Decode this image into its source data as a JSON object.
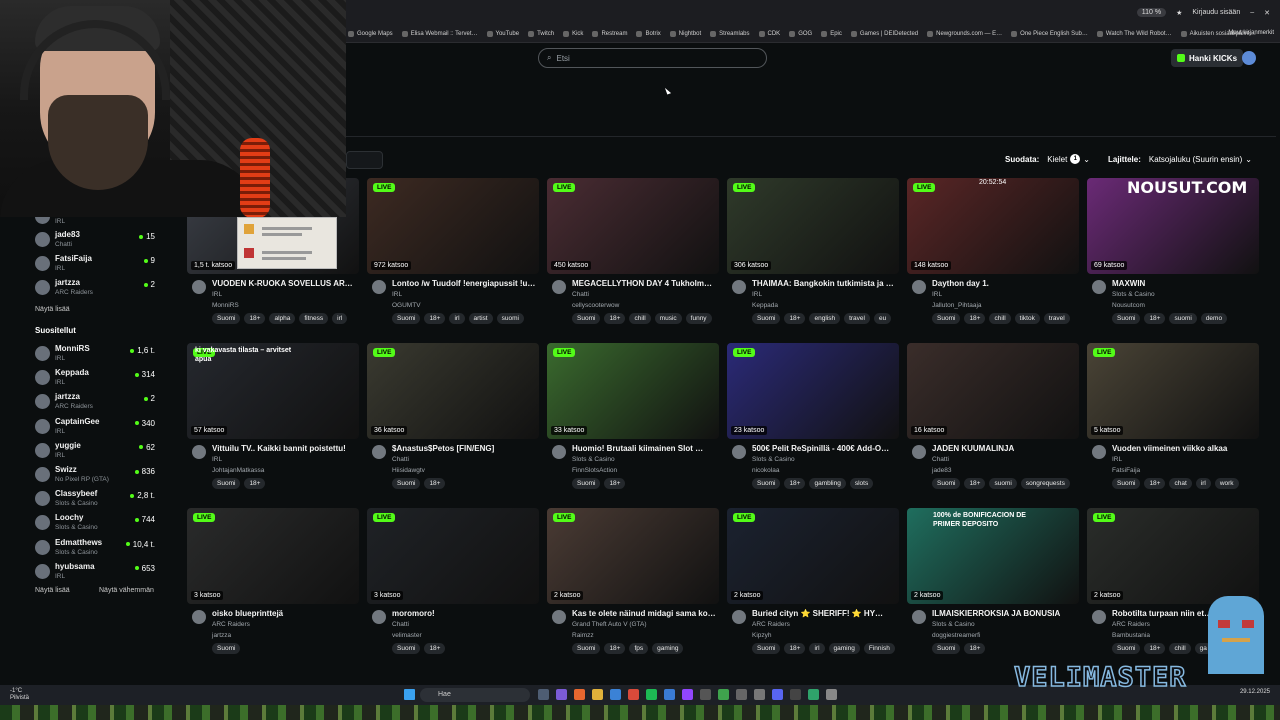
{
  "browser": {
    "zoom": "110 %",
    "account_label": "Kirjaudu sisään",
    "bookmarks": [
      "Google Maps",
      "Elisa Webmail :: Tervet…",
      "YouTube",
      "Twitch",
      "Kick",
      "Restream",
      "Botrix",
      "Nightbot",
      "Streamlabs",
      "CDK",
      "GOG",
      "Epic",
      "Games | DEIDetected",
      "Newgrounds.com — E…",
      "One Piece English Sub…",
      "Watch The Wild Robot…",
      "Aikuisten sosiaalipalve…"
    ],
    "bookmarks_more": "Muut kirjanmerkit"
  },
  "header": {
    "search_placeholder": "Etsi",
    "kicks_label": "Hanki KICKs"
  },
  "filters": {
    "sort_label": "Suodata:",
    "languages_label": "Kielet",
    "languages_count": "1",
    "order_label": "Lajittele:",
    "order_value": "Katsojaluku (Suurin ensin)"
  },
  "sidebar": {
    "following_partial": [
      {
        "name": "",
        "category": "IRL",
        "viewers": ""
      },
      {
        "name": "jade83",
        "category": "Chatti",
        "viewers": "15"
      },
      {
        "name": "FatsiFaija",
        "category": "IRL",
        "viewers": "9"
      },
      {
        "name": "jartzza",
        "category": "ARC Raiders",
        "viewers": "2"
      }
    ],
    "show_more_1": "Näytä lisää",
    "recommended_heading": "Suositellut",
    "recommended": [
      {
        "name": "MonniRS",
        "category": "IRL",
        "viewers": "1,6 t."
      },
      {
        "name": "Keppada",
        "category": "IRL",
        "viewers": "314"
      },
      {
        "name": "jartzza",
        "category": "ARC Raiders",
        "viewers": "2"
      },
      {
        "name": "CaptainGee",
        "category": "IRL",
        "viewers": "340"
      },
      {
        "name": "yuggie",
        "category": "IRL",
        "viewers": "62"
      },
      {
        "name": "Swizz",
        "category": "No Pixel RP (GTA)",
        "viewers": "836"
      },
      {
        "name": "Classybeef",
        "category": "Slots & Casino",
        "viewers": "2,8 t."
      },
      {
        "name": "Loochy",
        "category": "Slots & Casino",
        "viewers": "744"
      },
      {
        "name": "Edmatthews",
        "category": "Slots & Casino",
        "viewers": "10,4 t."
      },
      {
        "name": "hyubsama",
        "category": "IRL",
        "viewers": "653"
      }
    ],
    "show_more_2": "Näytä lisää",
    "show_less": "Näytä vähemmän"
  },
  "cards": [
    {
      "title": "VUODEN K-RUOKA SOVELLUS ARV…",
      "category": "IRL",
      "channel": "MonniRS",
      "viewers": "1,5 t. katsoo",
      "live": "",
      "tags": [
        "Suomi",
        "18+",
        "alpha",
        "fitness",
        "irl"
      ],
      "color": "#3b3f47"
    },
    {
      "title": "Lontoo /w Tuudolf !energiapussit !u…",
      "category": "IRL",
      "channel": "OGUMTV",
      "viewers": "972 katsoo",
      "live": "LIVE",
      "tags": [
        "Suomi",
        "18+",
        "irl",
        "artist",
        "suomi"
      ],
      "color": "#3d2a22"
    },
    {
      "title": "MEGACELLYTHON DAY 4 Tukholm…",
      "category": "Chatti",
      "channel": "cellyscooterwow",
      "viewers": "450 katsoo",
      "live": "LIVE",
      "tags": [
        "Suomi",
        "18+",
        "chill",
        "music",
        "funny"
      ],
      "color": "#4a2c33"
    },
    {
      "title": "THAIMAA: Bangkokin tutkimista ja …",
      "category": "IRL",
      "channel": "Keppada",
      "viewers": "306 katsoo",
      "live": "LIVE",
      "tags": [
        "Suomi",
        "18+",
        "english",
        "travel",
        "eu"
      ],
      "color": "#2f3a2a"
    },
    {
      "title": "Daython day 1.",
      "category": "IRL",
      "channel": "Jalluton_Pihtaaja",
      "viewers": "148 katsoo",
      "live": "LIVE",
      "tags": [
        "Suomi",
        "18+",
        "chill",
        "tiktok",
        "travel"
      ],
      "color": "#5a2626"
    },
    {
      "title": "MAXWIN",
      "category": "Slots & Casino",
      "channel": "Nousutcom",
      "viewers": "69 katsoo",
      "live": "",
      "tags": [
        "Suomi",
        "18+",
        "suomi",
        "demo"
      ],
      "color": "#6a2a76"
    },
    {
      "title": "Vittuilu TV.. Kaikki bannit poistettu!",
      "category": "IRL",
      "channel": "JohtajanMatkassa",
      "viewers": "57 katsoo",
      "live": "LIVE",
      "tags": [
        "Suomi",
        "18+"
      ],
      "color": "#25282e"
    },
    {
      "title": "$Anastus$Petos [FIN/ENG]",
      "category": "Chatti",
      "channel": "Hiisidawgtv",
      "viewers": "36 katsoo",
      "live": "LIVE",
      "tags": [
        "Suomi",
        "18+"
      ],
      "color": "#3a3a30"
    },
    {
      "title": "Huomio! Brutaali kiimainen Slot …",
      "category": "Slots & Casino",
      "channel": "FinnSlotsAction",
      "viewers": "33 katsoo",
      "live": "LIVE",
      "tags": [
        "Suomi",
        "18+"
      ],
      "color": "#3a6a2e"
    },
    {
      "title": "500€ Pelit ReSpinillä - 400€ Add-O…",
      "category": "Slots & Casino",
      "channel": "nicokolaa",
      "viewers": "23 katsoo",
      "live": "LIVE",
      "tags": [
        "Suomi",
        "18+",
        "gambling",
        "slots"
      ],
      "color": "#2b2a78"
    },
    {
      "title": "JADEN KUUMALINJA",
      "category": "Chatti",
      "channel": "jade83",
      "viewers": "16 katsoo",
      "live": "",
      "tags": [
        "Suomi",
        "18+",
        "suomi",
        "songrequests"
      ],
      "color": "#3a2d2a"
    },
    {
      "title": "Vuoden viimeinen viikko alkaa",
      "category": "IRL",
      "channel": "FatsiFaija",
      "viewers": "5 katsoo",
      "live": "LIVE",
      "tags": [
        "Suomi",
        "18+",
        "chat",
        "irl",
        "work"
      ],
      "color": "#4a4436"
    },
    {
      "title": "oisko blueprinttejä",
      "category": "ARC Raiders",
      "channel": "jartzza",
      "viewers": "3 katsoo",
      "live": "LIVE",
      "tags": [
        "Suomi"
      ],
      "color": "#2a2b2b"
    },
    {
      "title": "moromoro!",
      "category": "Chatti",
      "channel": "velimaster",
      "viewers": "3 katsoo",
      "live": "LIVE",
      "tags": [
        "Suomi",
        "18+"
      ],
      "color": "#1f2226"
    },
    {
      "title": "Kas te olete näinud midagi sama ko…",
      "category": "Grand Theft Auto V (GTA)",
      "channel": "Raimzz",
      "viewers": "2 katsoo",
      "live": "LIVE",
      "tags": [
        "Suomi",
        "18+",
        "fps",
        "gaming"
      ],
      "color": "#4a3b34"
    },
    {
      "title": "Buried cityn ⭐ SHERIFF! ⭐ HY…",
      "category": "ARC Raiders",
      "channel": "Kipzyh",
      "viewers": "2 katsoo",
      "live": "LIVE",
      "tags": [
        "Suomi",
        "18+",
        "irl",
        "gaming",
        "Finnish"
      ],
      "color": "#1b2230"
    },
    {
      "title": "ILMAISKIERROKSIA JA BONUSIA",
      "category": "Slots & Casino",
      "channel": "doggiestreamerfi",
      "viewers": "2 katsoo",
      "live": "",
      "tags": [
        "Suomi",
        "18+"
      ],
      "color": "#1f6e5e"
    },
    {
      "title": "Robotilta turpaan niin et…",
      "category": "ARC Raiders",
      "channel": "Bambustania",
      "viewers": "2 katsoo",
      "live": "LIVE",
      "tags": [
        "Suomi",
        "18+",
        "chill",
        "ga"
      ],
      "color": "#2a2d2a"
    }
  ],
  "overlays": {
    "card7_banner": "ki vakavasta tilasta – arvitset apua",
    "nousut": "NOUSUT.COM",
    "time_stamp": "20:52:54",
    "bonus_banner": "100% de BONIFICACION DE PRIMER DEPOSITO"
  },
  "taskbar": {
    "weather_temp": "-1°C",
    "weather_desc": "Pilvistä",
    "search": "Hae",
    "date": "29.12.2025"
  },
  "brand": "VELIMASTER",
  "colors": {
    "accent": "#53fc18",
    "background": "#0b0e0f"
  }
}
